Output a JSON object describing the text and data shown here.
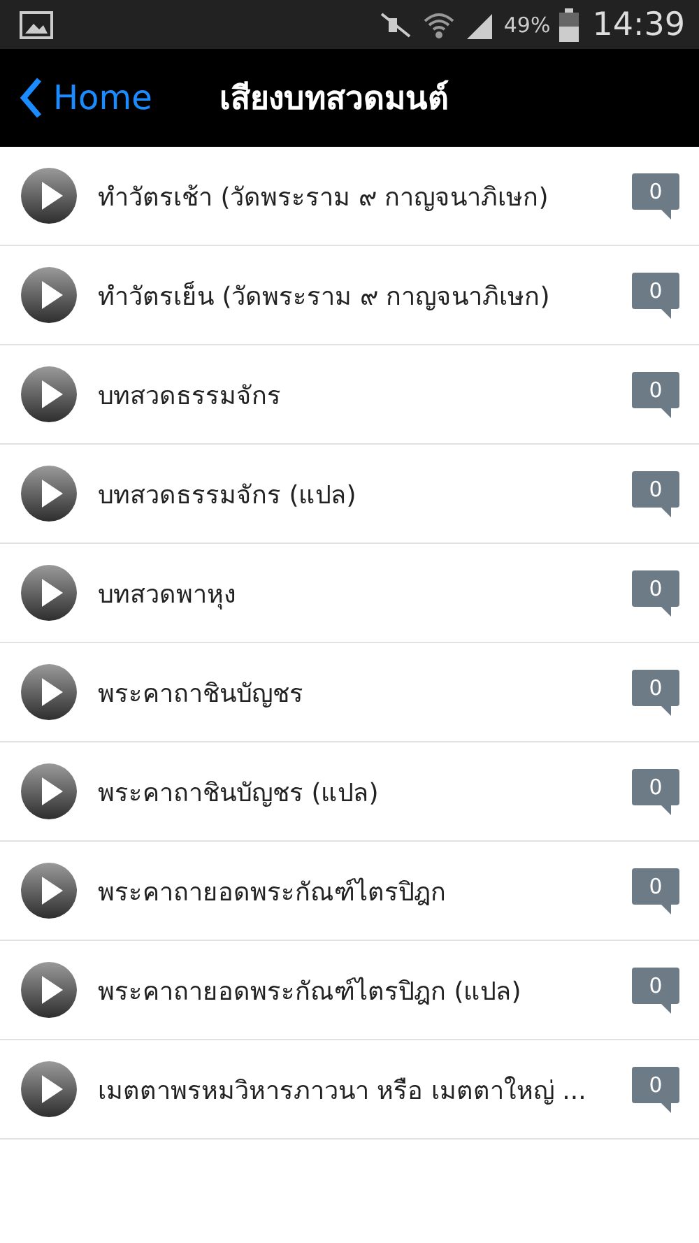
{
  "status_bar": {
    "battery": "49%",
    "time": "14:39"
  },
  "header": {
    "back": "Home",
    "title": "เสียงบทสวดมนต์"
  },
  "items": [
    {
      "title": "ทำวัตรเช้า (วัดพระราม ๙ กาญจนาภิเษก)",
      "count": "0"
    },
    {
      "title": "ทำวัตรเย็น (วัดพระราม ๙ กาญจนาภิเษก)",
      "count": "0"
    },
    {
      "title": "บทสวดธรรมจักร",
      "count": "0"
    },
    {
      "title": "บทสวดธรรมจักร (แปล)",
      "count": "0"
    },
    {
      "title": "บทสวดพาหุง",
      "count": "0"
    },
    {
      "title": "พระคาถาชินบัญชร",
      "count": "0"
    },
    {
      "title": "พระคาถาชินบัญชร (แปล)",
      "count": "0"
    },
    {
      "title": "พระคาถายอดพระกัณฑ์ไตรปิฎก",
      "count": "0"
    },
    {
      "title": "พระคาถายอดพระกัณฑ์ไตรปิฎก (แปล)",
      "count": "0"
    },
    {
      "title": "เมตตาพรหมวิหารภาวนา หรือ เมตตาใหญ่ ...",
      "count": "0"
    }
  ]
}
